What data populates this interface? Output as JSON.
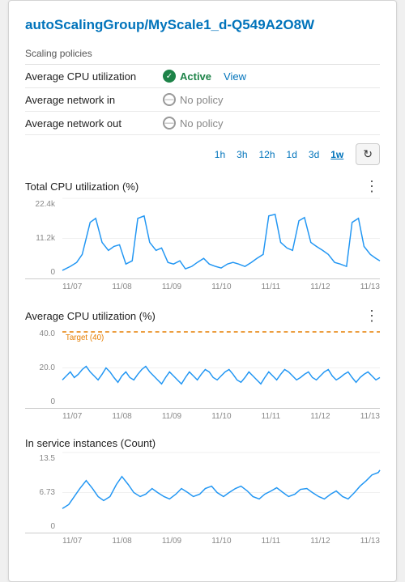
{
  "card": {
    "title": "autoScalingGroup/MyScale1_d-Q549A2O8W",
    "scaling_policies_label": "Scaling policies",
    "policies": [
      {
        "name": "Average CPU utilization",
        "status": "active",
        "status_text": "Active",
        "view_label": "View"
      },
      {
        "name": "Average network in",
        "status": "no_policy",
        "status_text": "No policy"
      },
      {
        "name": "Average network out",
        "status": "no_policy",
        "status_text": "No policy"
      }
    ],
    "time_controls": {
      "options": [
        "1h",
        "3h",
        "12h",
        "1d",
        "3d",
        "1w"
      ],
      "active": "1w"
    },
    "charts": [
      {
        "id": "total-cpu",
        "title": "Total CPU utilization (%)",
        "y_max": "22.4k",
        "y_mid": "11.2k",
        "y_min": "0",
        "x_labels": [
          "11/07",
          "11/08",
          "11/09",
          "11/10",
          "11/11",
          "11/12",
          "11/13"
        ],
        "has_target": false
      },
      {
        "id": "avg-cpu",
        "title": "Average CPU utilization (%)",
        "y_max": "40.0",
        "y_mid": "20.0",
        "y_min": "0",
        "x_labels": [
          "11/07",
          "11/08",
          "11/09",
          "11/10",
          "11/11",
          "11/12",
          "11/13"
        ],
        "has_target": true,
        "target_value": "Target (40)",
        "target_y_pct": 0
      },
      {
        "id": "in-service",
        "title": "In service instances (Count)",
        "y_max": "13.5",
        "y_mid": "6.73",
        "y_min": "0",
        "x_labels": [
          "11/07",
          "11/08",
          "11/09",
          "11/10",
          "11/11",
          "11/12",
          "11/13"
        ],
        "has_target": false
      }
    ]
  }
}
